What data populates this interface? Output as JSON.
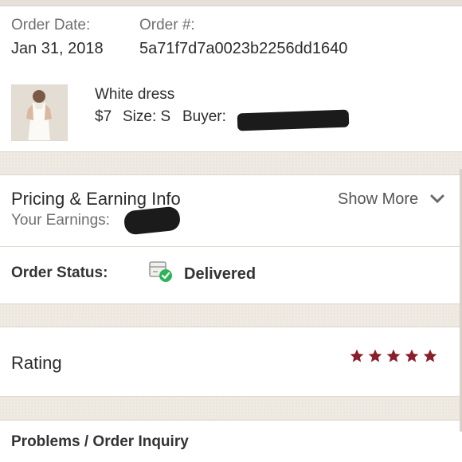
{
  "order": {
    "date_label": "Order Date:",
    "date_value": "Jan 31, 2018",
    "number_label": "Order #:",
    "number_value": "5a71f7d7a0023b2256dd1640"
  },
  "item": {
    "title": "White dress",
    "price": "$7",
    "size": "Size: S",
    "buyer_label": "Buyer:"
  },
  "pricing": {
    "title": "Pricing & Earning Info",
    "earnings_label": "Your Earnings:",
    "show_more": "Show More"
  },
  "status": {
    "label": "Order Status:",
    "value": "Delivered",
    "icon": "delivered-box-icon"
  },
  "rating": {
    "label": "Rating",
    "stars": 5,
    "max_stars": 5,
    "star_color": "#8b1e2b"
  },
  "problems": {
    "label": "Problems / Order Inquiry"
  },
  "colors": {
    "check_green": "#2fb35a",
    "background": "#ece7df"
  }
}
